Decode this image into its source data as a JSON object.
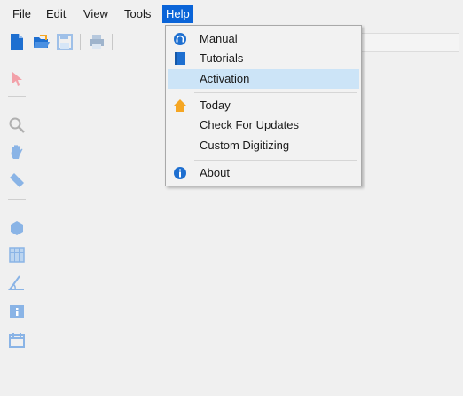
{
  "menubar": {
    "items": [
      {
        "label": "File"
      },
      {
        "label": "Edit"
      },
      {
        "label": "View"
      },
      {
        "label": "Tools"
      },
      {
        "label": "Help",
        "active": true
      }
    ]
  },
  "help_menu": {
    "items": [
      {
        "label": "Manual",
        "icon": "headset-icon"
      },
      {
        "label": "Tutorials",
        "icon": "book-icon"
      },
      {
        "label": "Activation",
        "icon": "",
        "highlighted": true
      },
      {
        "label": "Today",
        "icon": "home-icon"
      },
      {
        "label": "Check For Updates",
        "icon": ""
      },
      {
        "label": "Custom Digitizing",
        "icon": ""
      },
      {
        "label": "About",
        "icon": "info-icon"
      }
    ]
  },
  "toolbar": {
    "icons": [
      "new-file-icon",
      "open-folder-icon",
      "save-icon",
      "print-icon"
    ]
  },
  "side_tools": {
    "icons": [
      "pointer-icon",
      "zoom-icon",
      "pan-hand-icon",
      "ruler-icon",
      "shape-icon",
      "grid-icon",
      "angle-icon",
      "info-panel-icon",
      "calendar-icon"
    ]
  },
  "colors": {
    "menu_active_bg": "#0a64d8",
    "menu_highlight_bg": "#cce4f7",
    "icon_blue": "#1e6fd0",
    "icon_orange": "#f5a623"
  }
}
